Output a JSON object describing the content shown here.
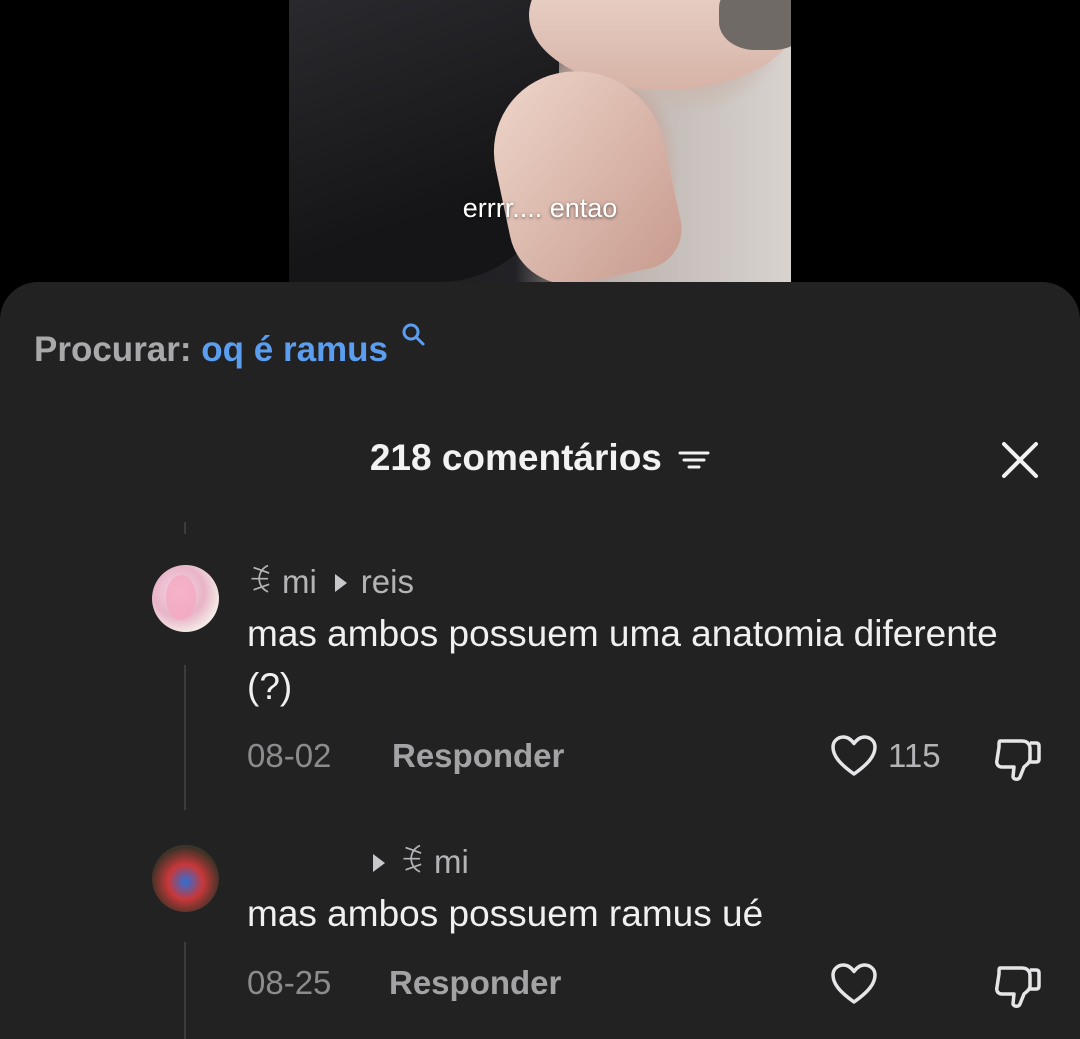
{
  "video": {
    "caption": "errrr.... entao"
  },
  "search": {
    "prefix": "Procurar:",
    "query": "oq é ramus"
  },
  "comments_header": {
    "title": "218 comentários"
  },
  "comments": [
    {
      "author": "ꉂ mi",
      "reply_to": "reis",
      "text": "mas ambos possuem uma anatomia diferente (?)",
      "date": "08-02",
      "reply_label": "Responder",
      "likes": "115"
    },
    {
      "author": "",
      "reply_to": "ꉂ mi",
      "text": "mas ambos possuem ramus ué",
      "date": "08-25",
      "reply_label": "Responder",
      "likes": ""
    }
  ],
  "colors": {
    "sheet_bg": "#222223",
    "accent_blue": "#5b9ef0"
  }
}
